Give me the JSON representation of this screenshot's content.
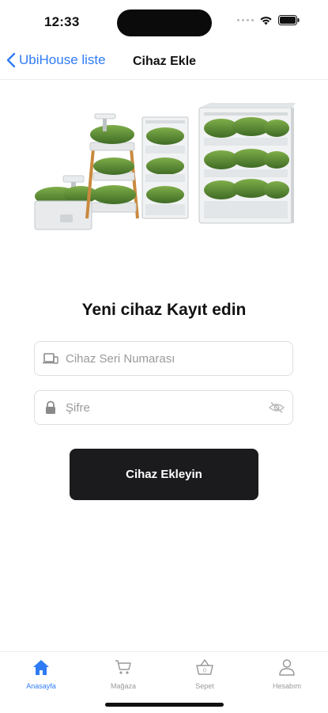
{
  "status_bar": {
    "time": "12:33"
  },
  "nav": {
    "back_label": "UbiHouse liste",
    "title": "Cihaz Ekle"
  },
  "heading": "Yeni cihaz Kayıt edin",
  "form": {
    "serial_placeholder": "Cihaz Seri Numarası",
    "serial_value": "",
    "password_placeholder": "Şifre",
    "password_value": "",
    "submit_label": "Cihaz Ekleyin"
  },
  "tabs": [
    {
      "label": "Anasayfa",
      "icon": "home-icon",
      "active": true
    },
    {
      "label": "Mağaza",
      "icon": "cart-icon",
      "active": false
    },
    {
      "label": "Sepet",
      "icon": "basket-icon",
      "active": false
    },
    {
      "label": "Hesabım",
      "icon": "person-icon",
      "active": false
    }
  ],
  "colors": {
    "accent": "#2f7bf5",
    "button": "#1b1b1d",
    "inactive": "#9a9a9a"
  }
}
